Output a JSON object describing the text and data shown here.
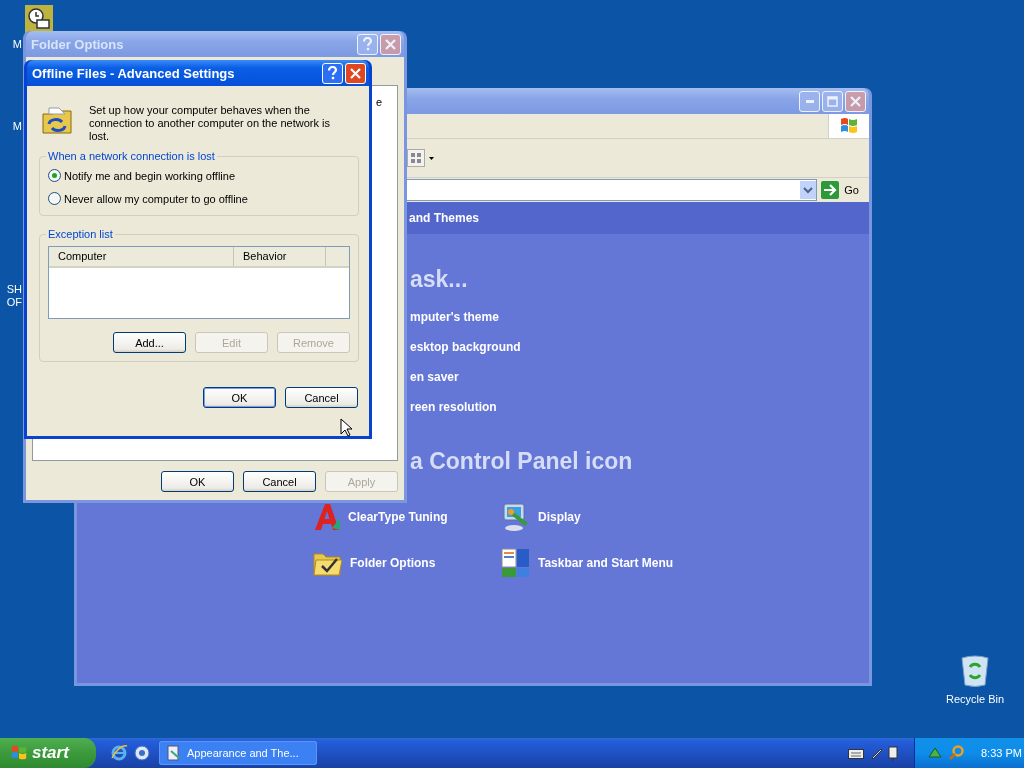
{
  "desktop_icons": [
    {
      "label_lines": [
        "M"
      ]
    },
    {
      "label_lines": [
        "M"
      ]
    },
    {
      "label_lines": [
        "SH",
        "OF"
      ]
    }
  ],
  "recycle_bin": {
    "label": "Recycle Bin"
  },
  "control_panel": {
    "active": false,
    "go": "Go",
    "header": "and Themes",
    "task_heading": "ask...",
    "tasks": [
      "mputer's theme",
      "esktop background",
      "en saver",
      "reen resolution"
    ],
    "icon_heading": "a Control Panel icon",
    "icons": [
      {
        "kind": "font",
        "label": "ClearType Tuning"
      },
      {
        "kind": "display",
        "label": "Display"
      },
      {
        "kind": "folder",
        "label": "Folder Options"
      },
      {
        "kind": "taskbar",
        "label": "Taskbar and Start Menu"
      }
    ]
  },
  "folder_options": {
    "title": "Folder Options",
    "active": false,
    "tab_text": "e",
    "buttons": [
      {
        "label": "OK",
        "disabled": false
      },
      {
        "label": "Cancel",
        "disabled": false
      },
      {
        "label": "Apply",
        "disabled": true
      }
    ]
  },
  "offline_dialog": {
    "title": "Offline Files - Advanced Settings",
    "active": true,
    "description": "Set up how your computer behaves when the connection to another computer on the network is lost.",
    "network_group": {
      "label": "When a network connection is lost",
      "options": [
        {
          "label": "Notify me and begin working offline",
          "selected": true
        },
        {
          "label": "Never allow my computer to go offline",
          "selected": false
        }
      ]
    },
    "exception_group": {
      "label": "Exception list",
      "columns": [
        "Computer",
        "Behavior"
      ],
      "buttons": [
        {
          "label": "Add...",
          "disabled": false
        },
        {
          "label": "Edit",
          "disabled": true
        },
        {
          "label": "Remove",
          "disabled": true
        }
      ]
    },
    "buttons": [
      {
        "label": "OK",
        "disabled": false
      },
      {
        "label": "Cancel",
        "disabled": false
      }
    ]
  },
  "taskbar": {
    "start": "start",
    "tasks": [
      {
        "label": "Appearance and The...",
        "selected": false
      }
    ],
    "clock": "8:33 PM"
  }
}
